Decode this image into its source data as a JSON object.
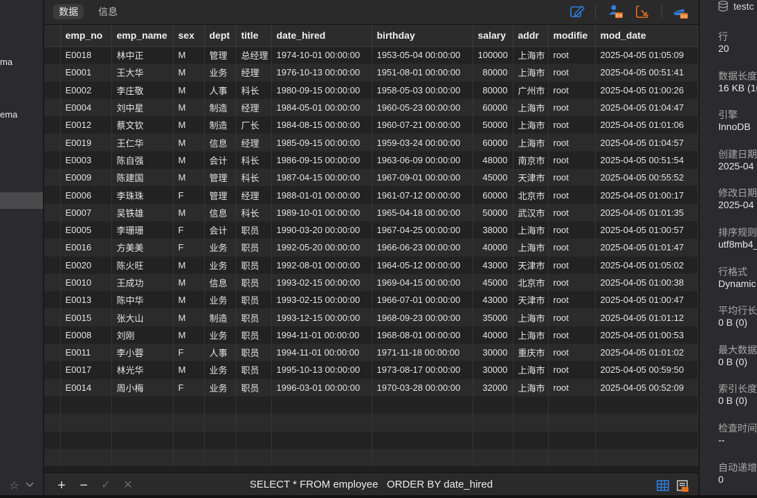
{
  "left_sidebar": {
    "items": [
      {
        "label": "ma"
      },
      {
        "label": "ema"
      },
      {
        "label": ""
      }
    ]
  },
  "tabs": [
    {
      "label": "数据",
      "active": true
    },
    {
      "label": "信息",
      "active": false
    }
  ],
  "toolbar": {
    "icons": [
      "edit-icon",
      "user-ent-icon",
      "export-icon",
      "ship-ent-icon"
    ]
  },
  "table": {
    "columns": [
      "emp_no",
      "emp_name",
      "sex",
      "dept",
      "title",
      "date_hired",
      "birthday",
      "salary",
      "addr",
      "modifie",
      "mod_date"
    ],
    "rows": [
      [
        "E0018",
        "林中正",
        "M",
        "管理",
        "总经理",
        "1974-10-01 00:00:00",
        "1953-05-04 00:00:00",
        "100000",
        "上海市",
        "root",
        "2025-04-05 01:05:09"
      ],
      [
        "E0001",
        "王大华",
        "M",
        "业务",
        "经理",
        "1976-10-13 00:00:00",
        "1951-08-01 00:00:00",
        "80000",
        "上海市",
        "root",
        "2025-04-05 00:51:41"
      ],
      [
        "E0002",
        "李庄敬",
        "M",
        "人事",
        "科长",
        "1980-09-15 00:00:00",
        "1958-05-03 00:00:00",
        "80000",
        "广州市",
        "root",
        "2025-04-05 01:00:26"
      ],
      [
        "E0004",
        "刘中星",
        "M",
        "制造",
        "经理",
        "1984-05-01 00:00:00",
        "1960-05-23 00:00:00",
        "60000",
        "上海市",
        "root",
        "2025-04-05 01:04:47"
      ],
      [
        "E0012",
        "蔡文钦",
        "M",
        "制造",
        "厂长",
        "1984-08-15 00:00:00",
        "1960-07-21 00:00:00",
        "50000",
        "上海市",
        "root",
        "2025-04-05 01:01:06"
      ],
      [
        "E0019",
        "王仁华",
        "M",
        "信息",
        "经理",
        "1985-09-15 00:00:00",
        "1959-03-24 00:00:00",
        "60000",
        "上海市",
        "root",
        "2025-04-05 01:04:57"
      ],
      [
        "E0003",
        "陈自强",
        "M",
        "会计",
        "科长",
        "1986-09-15 00:00:00",
        "1963-06-09 00:00:00",
        "48000",
        "南京市",
        "root",
        "2025-04-05 00:51:54"
      ],
      [
        "E0009",
        "陈建国",
        "M",
        "管理",
        "科长",
        "1987-04-15 00:00:00",
        "1967-09-01 00:00:00",
        "45000",
        "天津市",
        "root",
        "2025-04-05 00:55:52"
      ],
      [
        "E0006",
        "李珠珠",
        "F",
        "管理",
        "经理",
        "1988-01-01 00:00:00",
        "1961-07-12 00:00:00",
        "60000",
        "北京市",
        "root",
        "2025-04-05 01:00:17"
      ],
      [
        "E0007",
        "吴铁雄",
        "M",
        "信息",
        "科长",
        "1989-10-01 00:00:00",
        "1965-04-18 00:00:00",
        "50000",
        "武汉市",
        "root",
        "2025-04-05 01:01:35"
      ],
      [
        "E0005",
        "李珊珊",
        "F",
        "会计",
        "职员",
        "1990-03-20 00:00:00",
        "1967-04-25 00:00:00",
        "38000",
        "上海市",
        "root",
        "2025-04-05 01:00:57"
      ],
      [
        "E0016",
        "方美美",
        "F",
        "业务",
        "职员",
        "1992-05-20 00:00:00",
        "1966-06-23 00:00:00",
        "40000",
        "上海市",
        "root",
        "2025-04-05 01:01:47"
      ],
      [
        "E0020",
        "陈火旺",
        "M",
        "业务",
        "职员",
        "1992-08-01 00:00:00",
        "1964-05-12 00:00:00",
        "43000",
        "天津市",
        "root",
        "2025-04-05 01:05:02"
      ],
      [
        "E0010",
        "王成功",
        "M",
        "信息",
        "职员",
        "1993-02-15 00:00:00",
        "1969-04-15 00:00:00",
        "45000",
        "北京市",
        "root",
        "2025-04-05 01:00:38"
      ],
      [
        "E0013",
        "陈中华",
        "M",
        "业务",
        "职员",
        "1993-02-15 00:00:00",
        "1966-07-01 00:00:00",
        "43000",
        "天津市",
        "root",
        "2025-04-05 01:00:47"
      ],
      [
        "E0015",
        "张大山",
        "M",
        "制造",
        "职员",
        "1993-12-15 00:00:00",
        "1968-09-23 00:00:00",
        "35000",
        "上海市",
        "root",
        "2025-04-05 01:01:12"
      ],
      [
        "E0008",
        "刘刚",
        "M",
        "业务",
        "职员",
        "1994-11-01 00:00:00",
        "1968-08-01 00:00:00",
        "40000",
        "上海市",
        "root",
        "2025-04-05 01:00:53"
      ],
      [
        "E0011",
        "李小蓉",
        "F",
        "人事",
        "职员",
        "1994-11-01 00:00:00",
        "1971-11-18 00:00:00",
        "30000",
        "重庆市",
        "root",
        "2025-04-05 01:01:02"
      ],
      [
        "E0017",
        "林光华",
        "M",
        "业务",
        "职员",
        "1995-10-13 00:00:00",
        "1973-08-17 00:00:00",
        "30000",
        "上海市",
        "root",
        "2025-04-05 00:59:50"
      ],
      [
        "E0014",
        "周小梅",
        "F",
        "业务",
        "职员",
        "1996-03-01 00:00:00",
        "1970-03-28 00:00:00",
        "32000",
        "上海市",
        "root",
        "2025-04-05 00:52:09"
      ]
    ]
  },
  "bottom_bar": {
    "add": "+",
    "remove": "−",
    "apply": "✓",
    "discard": "✕",
    "sql": "SELECT * FROM employee   ORDER BY date_hired"
  },
  "right_panel": {
    "title": "testc",
    "fields": [
      {
        "label": "行",
        "value": "20"
      },
      {
        "label": "数据长度",
        "value": "16 KB (16"
      },
      {
        "label": "引擎",
        "value": "InnoDB"
      },
      {
        "label": "创建日期",
        "value": "2025-04"
      },
      {
        "label": "修改日期",
        "value": "2025-04"
      },
      {
        "label": "排序规则",
        "value": "utf8mb4_"
      },
      {
        "label": "行格式",
        "value": "Dynamic"
      },
      {
        "label": "平均行长",
        "value": "0 B (0)"
      },
      {
        "label": "最大数据",
        "value": "0 B (0)"
      },
      {
        "label": "索引长度",
        "value": "0 B (0)"
      },
      {
        "label": "检查时间",
        "value": "--"
      },
      {
        "label": "自动递增",
        "value": "0"
      }
    ]
  },
  "colors": {
    "accent_blue": "#2f7fe0",
    "ent_orange": "#e8711c"
  }
}
